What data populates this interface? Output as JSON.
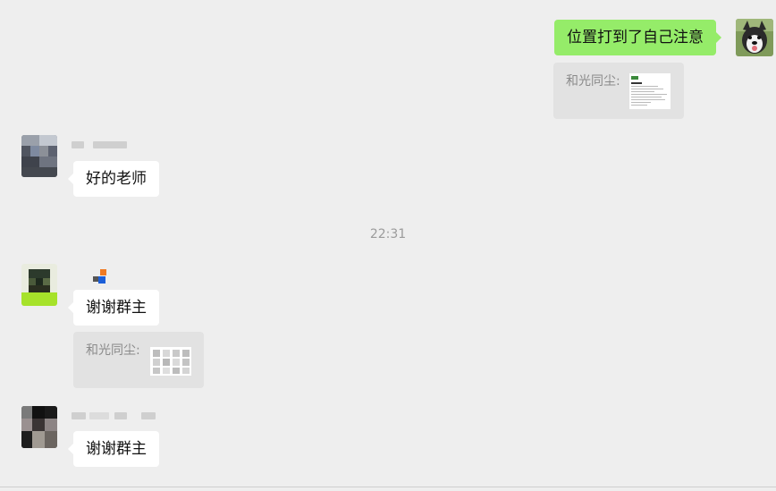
{
  "chat": {
    "self_message": {
      "text": "位置打到了自己注意",
      "quote_label": "和光同尘:"
    },
    "timestamp": "22:31",
    "messages": [
      {
        "text": "好的老师"
      },
      {
        "text": "谢谢群主",
        "quote_label": "和光同尘:"
      },
      {
        "text": "谢谢群主"
      }
    ]
  },
  "colors": {
    "background": "#eeeeee",
    "self_bubble": "#95ec69",
    "other_bubble": "#ffffff",
    "quote_bg": "#e2e2e2"
  }
}
